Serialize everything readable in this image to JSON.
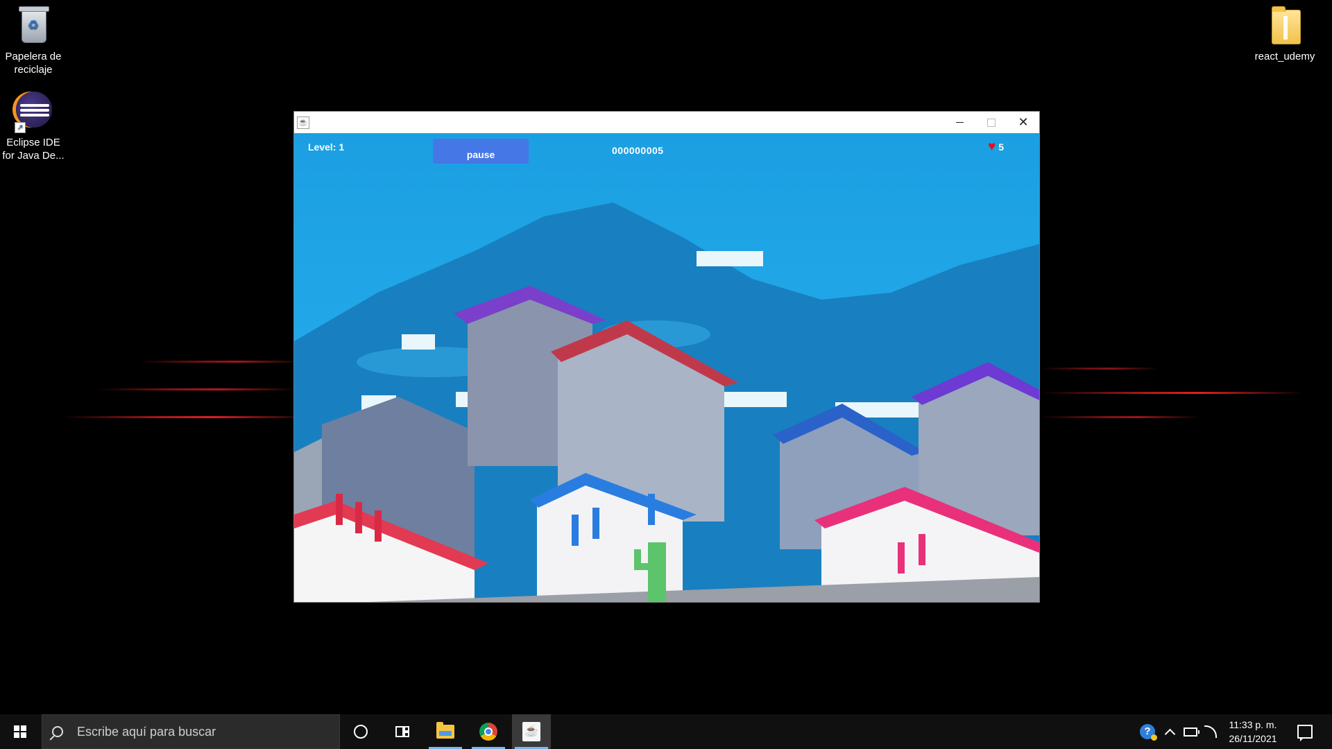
{
  "desktop": {
    "icons": [
      {
        "label": "Papelera de reciclaje"
      },
      {
        "label": "Eclipse IDE for Java De..."
      },
      {
        "label": "react_udemy"
      }
    ]
  },
  "window": {
    "controls": {
      "minimize": "—",
      "maximize": "☐",
      "close": "✕"
    }
  },
  "game": {
    "level_text": "Level: 1",
    "pause_label": "pause",
    "score": "000000005",
    "lives": "5",
    "heart_icon": "♥"
  },
  "taskbar": {
    "search_placeholder": "Escribe aquí para buscar",
    "clock_time": "11:33 p. m.",
    "clock_date": "26/11/2021"
  }
}
